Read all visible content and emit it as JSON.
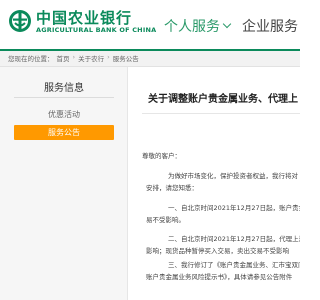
{
  "brand": {
    "name_cn": "中国农业银行",
    "name_en": "AGRICULTURAL BANK OF CHINA"
  },
  "nav": {
    "personal": "个人服务",
    "corporate": "企业服务"
  },
  "breadcrumb": {
    "prefix": "您现在的位置：",
    "items": [
      "首页",
      "关于农行",
      "服务公告"
    ],
    "sep": "›"
  },
  "sidebar": {
    "title": "服务信息",
    "items": [
      {
        "label": "优惠活动",
        "active": false
      },
      {
        "label": "服务公告",
        "active": true
      }
    ]
  },
  "article": {
    "title": "关于调整账户贵金属业务、代理上",
    "greeting": "尊敬的客户：",
    "paragraphs": [
      [
        "为做好市场变化，保护投资者权益，我行将对",
        "安排，请您知悉："
      ],
      [
        "一、自北京时间2021年12月27日起，账户贵金",
        "易不受影响。"
      ],
      [
        "二、自北京时间2021年12月27日起，代理上海",
        "影响；现货品种暂停买入交易，卖出交易不受影响"
      ],
      [
        "三、我行修订了《账户贵金属业务、汇市宝双向",
        "账户贵金属业务风险提示书》，具体请参见公告附件"
      ]
    ]
  },
  "colors": {
    "brand_green": "#0b8a5b",
    "active_orange": "#ff9900"
  }
}
